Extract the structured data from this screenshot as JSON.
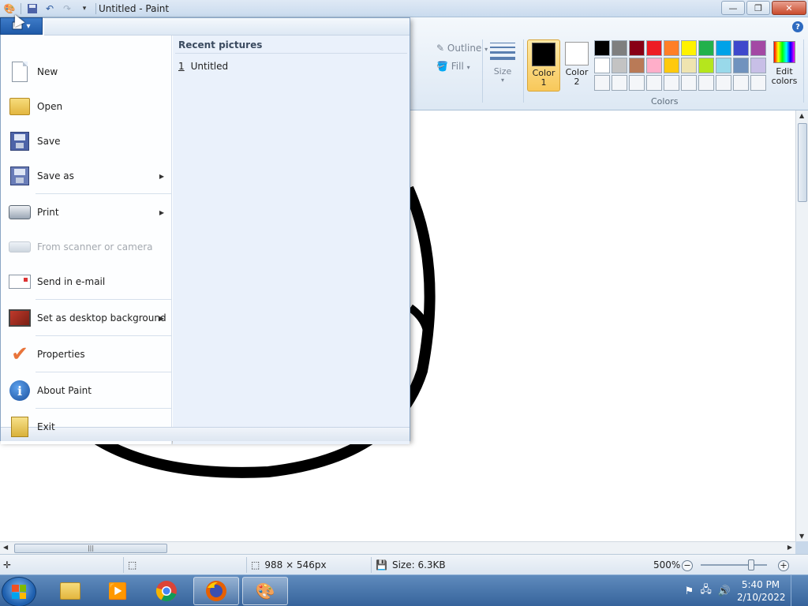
{
  "window": {
    "title": "Untitled - Paint",
    "minimize": "▭",
    "maximize": "❐",
    "close": "✕"
  },
  "qat": {
    "icons": [
      "paint-icon",
      "save-icon",
      "undo-icon",
      "redo-icon",
      "customize-icon"
    ]
  },
  "ribbon": {
    "menu_tab_glyph": "▾",
    "help": "?",
    "outline": "Outline",
    "fill": "Fill",
    "size": "Size",
    "color1": "Color\n1",
    "color1_line1": "Color",
    "color1_line2": "1",
    "color2_line1": "Color",
    "color2_line2": "2",
    "edit_colors_line1": "Edit",
    "edit_colors_line2": "colors",
    "colors_group": "Colors",
    "color1_value": "#000000",
    "color2_value": "#ffffff",
    "palette": [
      "#000000",
      "#7f7f7f",
      "#880015",
      "#ed1c24",
      "#ff7f27",
      "#fff200",
      "#22b14c",
      "#00a2e8",
      "#3f48cc",
      "#a349a4",
      "#ffffff",
      "#c3c3c3",
      "#b97a57",
      "#ffaec9",
      "#ffc90e",
      "#efe4b0",
      "#b5e61d",
      "#99d9ea",
      "#7092be",
      "#c8bfe7",
      "#f4f6f9",
      "#f4f6f9",
      "#f4f6f9",
      "#f4f6f9",
      "#f4f6f9",
      "#f4f6f9",
      "#f4f6f9",
      "#f4f6f9",
      "#f4f6f9",
      "#f4f6f9"
    ]
  },
  "appmenu": {
    "items": [
      {
        "label": "New",
        "icon": "new-file-icon",
        "submenu": false,
        "enabled": true
      },
      {
        "label": "Open",
        "icon": "open-folder-icon",
        "submenu": false,
        "enabled": true
      },
      {
        "label": "Save",
        "icon": "save-disk-icon",
        "submenu": false,
        "enabled": true
      },
      {
        "label": "Save as",
        "icon": "save-as-icon",
        "submenu": true,
        "enabled": true
      },
      {
        "label": "Print",
        "icon": "printer-icon",
        "submenu": true,
        "enabled": true
      },
      {
        "label": "From scanner or camera",
        "icon": "scanner-icon",
        "submenu": false,
        "enabled": false
      },
      {
        "label": "Send in e-mail",
        "icon": "email-icon",
        "submenu": false,
        "enabled": true
      },
      {
        "label": "Set as desktop background",
        "icon": "desktop-background-icon",
        "submenu": true,
        "enabled": true
      },
      {
        "label": "Properties",
        "icon": "properties-check-icon",
        "submenu": false,
        "enabled": true
      },
      {
        "label": "About Paint",
        "icon": "info-icon",
        "submenu": false,
        "enabled": true
      },
      {
        "label": "Exit",
        "icon": "exit-icon",
        "submenu": false,
        "enabled": true
      }
    ],
    "recent_title": "Recent pictures",
    "recent": [
      {
        "num": "1",
        "name": "Untitled"
      }
    ]
  },
  "statusbar": {
    "dimensions": "988 × 546px",
    "size": "Size: 6.3KB",
    "zoom": "500%",
    "zoom_minus": "−",
    "zoom_plus": "+"
  },
  "taskbar": {
    "apps": [
      "windows-explorer-icon",
      "media-player-icon",
      "chrome-icon",
      "firefox-icon",
      "paint-icon"
    ],
    "time": "5:40 PM",
    "date": "2/10/2022"
  }
}
